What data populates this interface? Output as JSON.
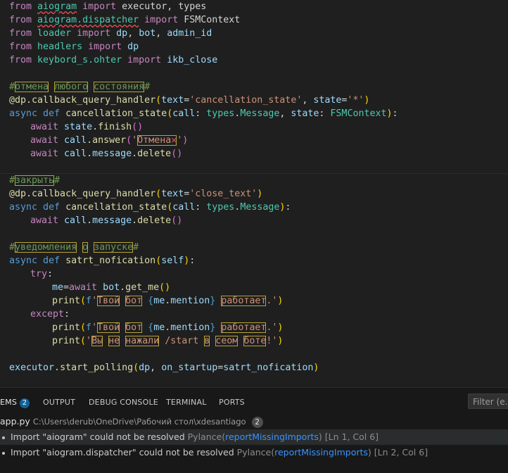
{
  "code": {
    "l1": {
      "kw1": "from",
      "mod": "aiogram",
      "kw2": "import",
      "names": "executor, types"
    },
    "l2": {
      "kw1": "from",
      "mod": "aiogram.dispatcher",
      "kw2": "import",
      "names": "FSMContext"
    },
    "l3": {
      "kw1": "from",
      "mod": "loader",
      "kw2": "import",
      "n1": "dp",
      "sep": ", ",
      "n2": "bot",
      "sep2": ", ",
      "n3": "admin_id"
    },
    "l4": {
      "kw1": "from",
      "mod": "headlers",
      "kw2": "import",
      "n1": "dp"
    },
    "l5": {
      "kw1": "from",
      "mod": "keybord_s.ohter",
      "kw2": "import",
      "n1": "ikb_close"
    },
    "c1": {
      "hash": "#",
      "w1": "отмена",
      "w2": "любого",
      "w3": "состояния",
      "hash2": "#"
    },
    "l7": {
      "at": "@dp.",
      "fn": "callback_query_handler",
      "arg1": "text",
      "eq": "=",
      "s1": "'cancellation_state'",
      "comma": ", ",
      "arg2": "state",
      "s2": "'*'"
    },
    "l8": {
      "kw1": "async",
      "kw2": "def",
      "fn": "cancellation_state",
      "p1": "call",
      "t1": "types",
      "t1b": "Message",
      "p2": "state",
      "t2": "FSMContext"
    },
    "l9": {
      "kw": "await",
      "obj": "state",
      "fn": "finish"
    },
    "l10": {
      "kw": "await",
      "obj": "call",
      "fn": "answer",
      "s": "Отмена",
      "x": "✕"
    },
    "l11": {
      "kw": "await",
      "obj": "call",
      "attr": "message",
      "fn": "delete"
    },
    "c2": {
      "hash": "#",
      "w1": "закрыть",
      "hash2": "#"
    },
    "l13": {
      "at": "@dp.",
      "fn": "callback_query_handler",
      "arg1": "text",
      "eq": "=",
      "s1": "'close_text'"
    },
    "l14": {
      "kw1": "async",
      "kw2": "def",
      "fn": "cancellation_state",
      "p1": "call",
      "t1": "types",
      "t1b": "Message"
    },
    "l15": {
      "kw": "await",
      "obj": "call",
      "attr": "message",
      "fn": "delete"
    },
    "c3": {
      "hash": "#",
      "w1": "уведомления",
      "w2": "о",
      "w3": "запуске",
      "hash2": "#"
    },
    "l17": {
      "kw1": "async",
      "kw2": "def",
      "fn": "satrt_nofication",
      "p1": "self"
    },
    "l18": {
      "kw": "try"
    },
    "l19": {
      "v": "me",
      "eq": "=",
      "kw": "await",
      "obj": "bot",
      "fn": "get_me"
    },
    "l20": {
      "fn": "print",
      "f": "f",
      "q": "'",
      "w1": "Твой",
      "w2": "бот",
      "me": "me",
      "attr": "mention",
      "w3": "работает",
      "tail": ".'"
    },
    "l21": {
      "kw": "except"
    },
    "l22": {
      "fn": "print",
      "f": "f",
      "q": "'",
      "w1": "Твой",
      "w2": "бот",
      "me": "me",
      "attr": "mention",
      "w3": "работает",
      "tail": ".'"
    },
    "l23": {
      "fn": "print",
      "q": "'",
      "w1": "Вы",
      "w2": "не",
      "w3": "нажали",
      "mid": "/start",
      "w4": "в",
      "w5": "сеом",
      "w6": "боте",
      "tail": "!'"
    },
    "l25": {
      "obj": "executor",
      "fn": "start_polling",
      "a1": "dp",
      "kw": "on_startup",
      "a2": "satrt_nofication"
    }
  },
  "panel": {
    "tabs": [
      {
        "label": "EMS",
        "badge": "2"
      },
      {
        "label": "OUTPUT"
      },
      {
        "label": "DEBUG CONSOLE"
      },
      {
        "label": "TERMINAL"
      },
      {
        "label": "PORTS"
      }
    ],
    "filter_placeholder": "Filter (e.g.",
    "file": {
      "name": "app.py",
      "path": "C:\\Users\\derub\\OneDrive\\Рабочий стол\\xdesantiago",
      "count": "2"
    },
    "problems": [
      {
        "msg": "Import \"aiogram\" could not be resolved",
        "source": "Pylance",
        "rule": "reportMissingImports",
        "loc": "[Ln 1, Col 6]"
      },
      {
        "msg": "Import \"aiogram.dispatcher\" could not be resolved",
        "source": "Pylance",
        "rule": "reportMissingImports",
        "loc": "[Ln 2, Col 6]"
      }
    ]
  }
}
